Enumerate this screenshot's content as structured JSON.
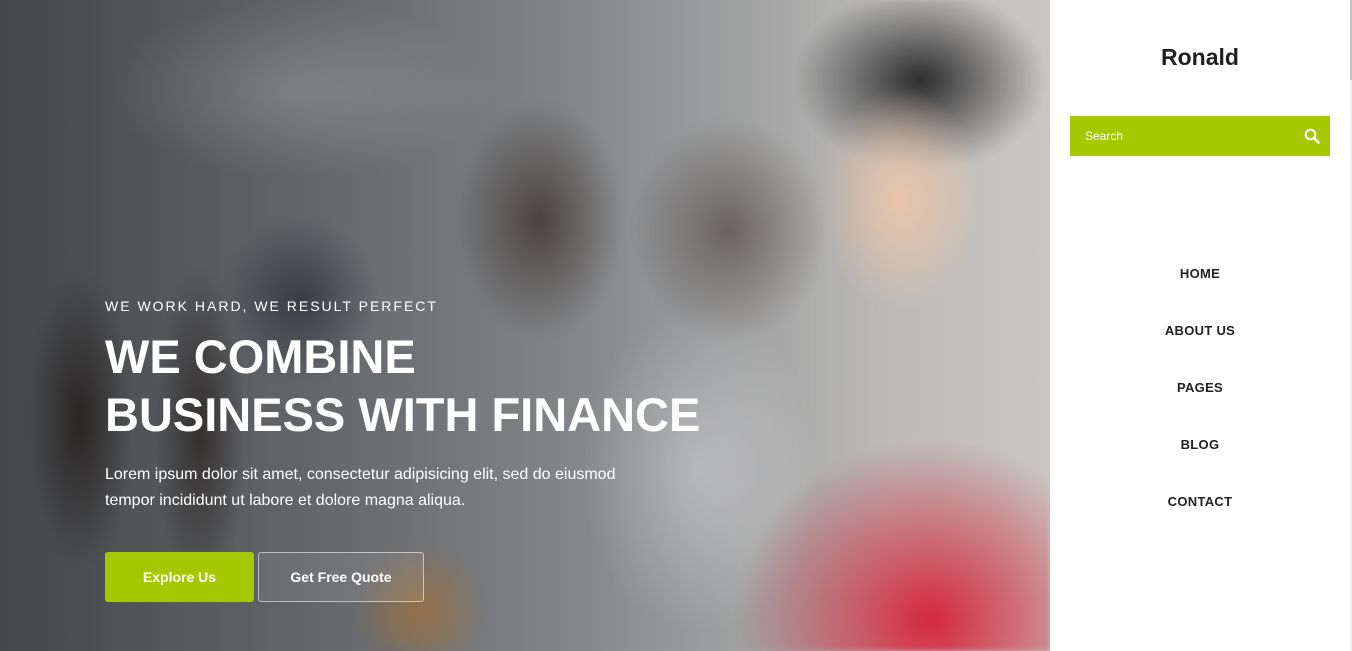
{
  "hero": {
    "tagline": "WE WORK HARD, WE RESULT PERFECT",
    "headline_line1": "WE COMBINE",
    "headline_line2": "BUSINESS WITH FINANCE",
    "description_line1": "Lorem ipsum dolor sit amet, consectetur adipisicing elit, sed do eiusmod",
    "description_line2": "tempor incididunt ut labore et dolore magna aliqua.",
    "primary_button": "Explore Us",
    "secondary_button": "Get Free Quote"
  },
  "sidebar": {
    "brand": "Ronald",
    "search": {
      "placeholder": "Search",
      "value": "",
      "icon": "search-icon"
    },
    "nav": [
      {
        "label": "HOME"
      },
      {
        "label": "ABOUT US"
      },
      {
        "label": "PAGES"
      },
      {
        "label": "BLOG"
      },
      {
        "label": "CONTACT"
      }
    ]
  },
  "colors": {
    "accent": "#a5c800",
    "text_dark": "#222222",
    "white": "#ffffff"
  }
}
